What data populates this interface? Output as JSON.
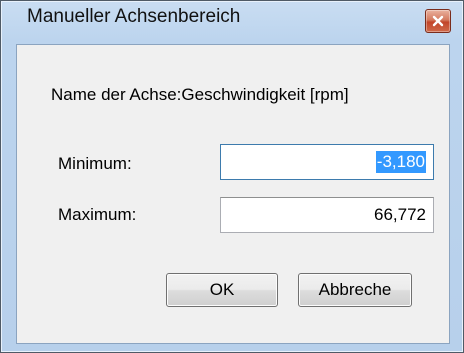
{
  "window": {
    "title": "Manueller Achsenbereich"
  },
  "dialog": {
    "axis_name_text": "Name der Achse:Geschwindigkeit [rpm]",
    "minimum": {
      "label": "Minimum:",
      "value": "-3,180",
      "selected": true
    },
    "maximum": {
      "label": "Maximum:",
      "value": "66,772"
    },
    "buttons": {
      "ok_label": "OK",
      "cancel_label": "Abbreche"
    }
  },
  "icons": {
    "close": "close-icon"
  },
  "colors": {
    "selection": "#3399ff",
    "close_button": "#c2452a",
    "frame": "#bcd4ee",
    "client": "#f0f0f0"
  }
}
